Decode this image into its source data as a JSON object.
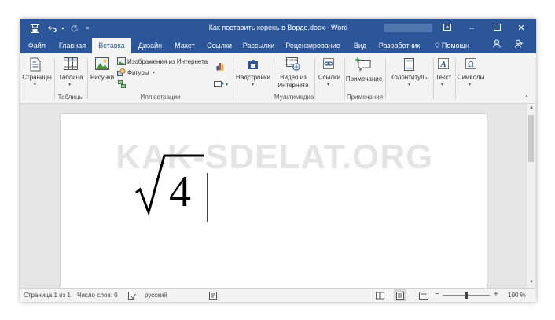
{
  "window": {
    "title": "Как поставить корень в Ворде.docx - Word"
  },
  "tabs": [
    {
      "label": "Файл"
    },
    {
      "label": "Главная"
    },
    {
      "label": "Вставка"
    },
    {
      "label": "Дизайн"
    },
    {
      "label": "Макет"
    },
    {
      "label": "Ссылки"
    },
    {
      "label": "Рассылки"
    },
    {
      "label": "Рецензирование"
    },
    {
      "label": "Вид"
    },
    {
      "label": "Разработчик"
    }
  ],
  "active_tab": "Вставка",
  "tell_me": "Помощн",
  "ribbon": {
    "pages": "Страницы",
    "table": "Таблица",
    "pictures": "Рисунки",
    "online_pictures": "Изображения из Интернета",
    "shapes": "Фигуры",
    "addins": "Надстройки",
    "online_video_l1": "Видео из",
    "online_video_l2": "Интернета",
    "links": "Ссылки",
    "comment": "Примечание",
    "header_footer": "Колонтитулы",
    "text": "Текст",
    "symbols": "Символы",
    "groups": {
      "tables": "Таблицы",
      "illustrations": "Иллюстрации",
      "media": "Мультимедиа",
      "comments": "Примечания"
    }
  },
  "document": {
    "watermark": "KAK-SDELAT.ORG",
    "radical": "√",
    "radicand": "4"
  },
  "status": {
    "page": "Страница 1 из 1",
    "words": "Число слов: 0",
    "language": "русский",
    "zoom": "100 %",
    "zoom_minus": "−",
    "zoom_plus": "+",
    "zoom_level": 0.5
  },
  "colors": {
    "word_blue": "#2b579a",
    "ribbon_bg": "#f3f3f3",
    "canvas_bg": "#e6e6e6"
  }
}
